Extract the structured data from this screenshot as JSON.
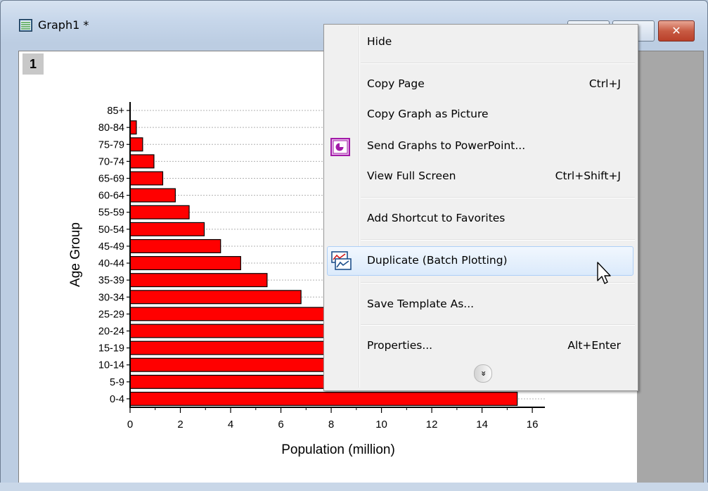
{
  "window": {
    "title": "Graph1 *",
    "close_glyph": "✕",
    "layer_number": "1",
    "icons": [
      "graph-window-icon",
      "minimize-icon",
      "maximize-icon",
      "close-icon"
    ]
  },
  "chart_data": {
    "type": "bar",
    "orientation": "horizontal",
    "categories": [
      "0-4",
      "5-9",
      "10-14",
      "15-19",
      "20-24",
      "25-29",
      "30-34",
      "35-39",
      "40-44",
      "45-49",
      "50-54",
      "55-59",
      "60-64",
      "65-69",
      "70-74",
      "75-79",
      "80-84",
      "85+"
    ],
    "values": [
      15.4,
      13.5,
      12.5,
      11.8,
      10.3,
      8.6,
      6.8,
      5.45,
      4.4,
      3.6,
      2.95,
      2.35,
      1.8,
      1.3,
      0.95,
      0.5,
      0.25,
      0.0
    ],
    "xlabel": "Population (million)",
    "ylabel": "Age Group",
    "xlim": [
      0,
      16.5
    ],
    "xticks": [
      "0",
      "2",
      "4",
      "6",
      "8",
      "10",
      "12",
      "14",
      "16"
    ],
    "grid": "dotted horizontal",
    "bar_color": "#ff0000",
    "bar_edge_color": "#000000"
  },
  "context_menu": {
    "items": [
      {
        "label": "Hide",
        "shortcut": ""
      },
      {
        "label": "Copy Page",
        "shortcut": "Ctrl+J"
      },
      {
        "label": "Copy Graph as Picture",
        "shortcut": ""
      },
      {
        "label": "Send Graphs to PowerPoint...",
        "shortcut": "",
        "icon": "powerpoint-icon"
      },
      {
        "label": "View Full Screen",
        "shortcut": "Ctrl+Shift+J"
      },
      {
        "label": "Add Shortcut to Favorites",
        "shortcut": ""
      },
      {
        "label": "Duplicate (Batch Plotting)",
        "shortcut": "",
        "icon": "duplicate-icon",
        "highlighted": true
      },
      {
        "label": "Save Template As...",
        "shortcut": ""
      },
      {
        "label": "Properties...",
        "shortcut": "Alt+Enter"
      }
    ],
    "more_glyph": "»",
    "more_icon": "expand-more-icon"
  },
  "cursor": "arrow-cursor-icon"
}
